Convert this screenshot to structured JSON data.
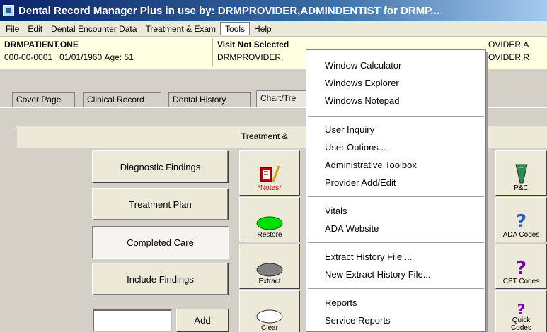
{
  "window": {
    "title": "Dental Record Manager Plus in use by: DRMPROVIDER,ADMINDENTIST for DRMP..."
  },
  "menu": [
    "File",
    "Edit",
    "Dental Encounter Data",
    "Treatment & Exam",
    "Tools",
    "Help"
  ],
  "patient": {
    "name": "DRMPATIENT,ONE",
    "ssn": "000-00-0001",
    "dob": "01/01/1960",
    "age_label": "Age:",
    "age": "51",
    "visit": "Visit Not Selected",
    "provider": "DRMPROVIDER,",
    "right_line1": "OVIDER,A",
    "right_line2": "OVIDER,R"
  },
  "tabs": [
    "Cover Page",
    "Clinical Record",
    "Dental History",
    "Chart/Tre"
  ],
  "treatment_label": "Treatment &",
  "left_buttons": [
    "Diagnostic Findings",
    "Treatment Plan",
    "Completed Care",
    "Include Findings"
  ],
  "add_button": "Add",
  "tool_buttons": [
    "*Notes*",
    "Restore",
    "Extract",
    "Clear"
  ],
  "right_buttons": [
    "P&C",
    "ADA Codes",
    "CPT Codes",
    "Quick Codes"
  ],
  "tools_menu": {
    "group1": [
      "Window Calculator",
      "Windows Explorer",
      "Windows Notepad"
    ],
    "group2": [
      "User Inquiry",
      "User Options...",
      "Administrative Toolbox",
      "Provider Add/Edit"
    ],
    "group3": [
      "Vitals",
      "ADA Website"
    ],
    "group4": [
      "Extract History File ...",
      "New Extract History File..."
    ],
    "group5": [
      "Reports",
      "Service Reports"
    ]
  },
  "colors": {
    "title_bar": "#0a246a",
    "notes_red": "#d00000",
    "restore_green": "#00e000",
    "extract_gray": "#808080",
    "qmark_purple": "#7a00b0",
    "qmark_blue": "#2a5fd0"
  }
}
